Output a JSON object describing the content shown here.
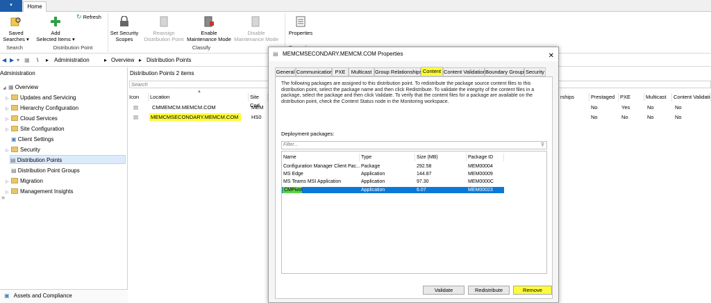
{
  "ribbon": {
    "file_button": "▾",
    "home_tab": "Home",
    "saved_searches": "Saved\nSearches ▾",
    "add_selected": "Add\nSelected Items ▾",
    "refresh": "Refresh",
    "set_security_scopes": "Set Security\nScopes",
    "reassign_dp": "Reassign\nDistribution Point",
    "enable_maintenance": "Enable\nMaintenance Mode",
    "disable_maintenance": "Disable\nMaintenance Mode",
    "properties": "Properties",
    "group_search": "Search",
    "group_distribution_point": "Distribution Point",
    "group_classify": "Classify",
    "group_properties": "Properties"
  },
  "address": {
    "crumbs": [
      "\\",
      "▸",
      "Administration",
      "▸",
      "Overview",
      "▸",
      "Distribution Points"
    ]
  },
  "nav": {
    "title": "Administration",
    "items": [
      {
        "label": "Overview"
      },
      {
        "label": "Updates and Servicing"
      },
      {
        "label": "Hierarchy Configuration"
      },
      {
        "label": "Cloud Services"
      },
      {
        "label": "Site Configuration"
      },
      {
        "label": "Client Settings"
      },
      {
        "label": "Security"
      },
      {
        "label": "Distribution Points"
      },
      {
        "label": "Distribution Point Groups"
      },
      {
        "label": "Migration"
      },
      {
        "label": "Management Insights"
      }
    ],
    "workspace": "Assets and Compliance"
  },
  "main": {
    "title": "Distribution Points 2 items",
    "search_placeholder": "Search",
    "columns": [
      "Icon",
      "Location",
      "Site Cod",
      "rships",
      "Prestaged",
      "PXE",
      "Multicast",
      "Content Validation"
    ],
    "rows": [
      {
        "location": "CMMEMCM.MEMCM.COM",
        "site": "MEM",
        "prestaged": "No",
        "pxe": "Yes",
        "multicast": "No",
        "validation": "No"
      },
      {
        "location": "MEMCMSECONDARY.MEMCM.COM",
        "site": "HS0",
        "prestaged": "No",
        "pxe": "No",
        "multicast": "No",
        "validation": "No"
      }
    ]
  },
  "dialog": {
    "title": "MEMCMSECONDARY.MEMCM.COM Properties",
    "close": "✕",
    "tabs": [
      "General",
      "Communication",
      "PXE",
      "Multicast",
      "Group Relationships",
      "Content",
      "Content Validation",
      "Boundary Groups",
      "Security"
    ],
    "description": "The following packages are assigned to this distribution point. To redistribute the package source content files to this distribution point, select the package name and then click Redistribute. To validate the integrity of the content files in a package, select the package and then click Validate. To verify that the content files for a package are available on the distribution point, check the Content Status node in the Monitoring workspace.",
    "deployment_label": "Deployment packages:",
    "filter_placeholder": "Filter...",
    "pkg_columns": [
      "Name",
      "Type",
      "Size (MB)",
      "Package ID"
    ],
    "packages": [
      {
        "name": "Configuration Manager Client Pac...",
        "type": "Package",
        "size": "292.58",
        "id": "MEM00004"
      },
      {
        "name": "MS Edge",
        "type": "Application",
        "size": "144.87",
        "id": "MEM00009"
      },
      {
        "name": "MS Teams MSI Application",
        "type": "Application",
        "size": "97.30",
        "id": "MEM0000C"
      },
      {
        "name": "CMPivot",
        "type": "Application",
        "size": "6.07",
        "id": "MEM00023"
      }
    ],
    "buttons": {
      "validate": "Validate",
      "redistribute": "Redistribute",
      "remove": "Remove"
    }
  },
  "colors": {
    "highlight": "#fdfb3b",
    "selection": "#0a78d7",
    "accent": "#1d5ca8"
  }
}
